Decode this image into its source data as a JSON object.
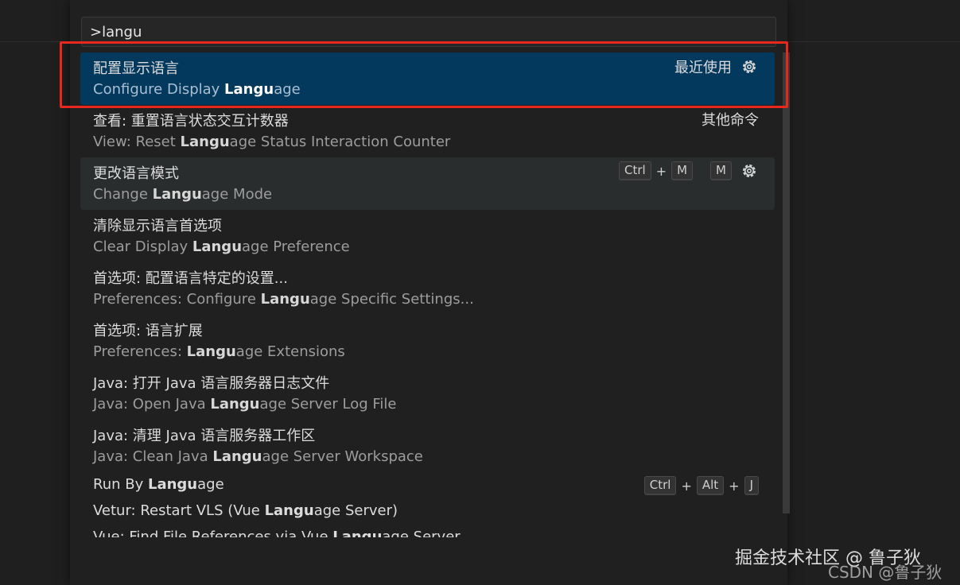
{
  "search": {
    "value": ">langu"
  },
  "items": [
    {
      "label": "配置显示语言",
      "sub_pre": "Configure Display ",
      "sub_hl": "Langu",
      "sub_post": "age",
      "right_text": "最近使用",
      "gear": "gear-icon"
    },
    {
      "label": "查看: 重置语言状态交互计数器",
      "sub_pre": "View: Reset ",
      "sub_hl": "Langu",
      "sub_post": "age Status Interaction Counter",
      "right_text": "其他命令"
    },
    {
      "label": "更改语言模式",
      "sub_pre": "Change ",
      "sub_hl": "Langu",
      "sub_post": "age Mode",
      "keys": [
        "Ctrl",
        "+",
        "M",
        "M"
      ],
      "gear": "gear-icon"
    },
    {
      "label": "清除显示语言首选项",
      "sub_pre": "Clear Display ",
      "sub_hl": "Langu",
      "sub_post": "age Preference"
    },
    {
      "label": "首选项: 配置语言特定的设置...",
      "sub_pre": "Preferences: Configure ",
      "sub_hl": "Langu",
      "sub_post": "age Specific Settings..."
    },
    {
      "label": "首选项: 语言扩展",
      "sub_pre": "Preferences: ",
      "sub_hl": "Langu",
      "sub_post": "age Extensions"
    },
    {
      "label": "Java: 打开 Java 语言服务器日志文件",
      "sub_pre": "Java: Open Java ",
      "sub_hl": "Langu",
      "sub_post": "age Server Log File"
    },
    {
      "label": "Java: 清理 Java 语言服务器工作区",
      "sub_pre": "Java: Clean Java ",
      "sub_hl": "Langu",
      "sub_post": "age Server Workspace"
    },
    {
      "label_pre": "Run By ",
      "label_hl": "Langu",
      "label_post": "age",
      "keys": [
        "Ctrl",
        "+",
        "Alt",
        "+",
        "J"
      ]
    },
    {
      "label_pre": "Vetur: Restart VLS (Vue ",
      "label_hl": "Langu",
      "label_post": "age Server)"
    },
    {
      "label_pre": "Vue: Find File References via Vue ",
      "label_hl": "Langu",
      "label_post": "age Server"
    }
  ],
  "watermark": {
    "line1": "掘金技术社区 @ 鲁子狄",
    "line2": "CSDN @鲁子狄"
  },
  "colors": {
    "selected_bg": "#04395e",
    "hover_bg": "#2a2d2e",
    "highlight_box": "#e8281f"
  }
}
